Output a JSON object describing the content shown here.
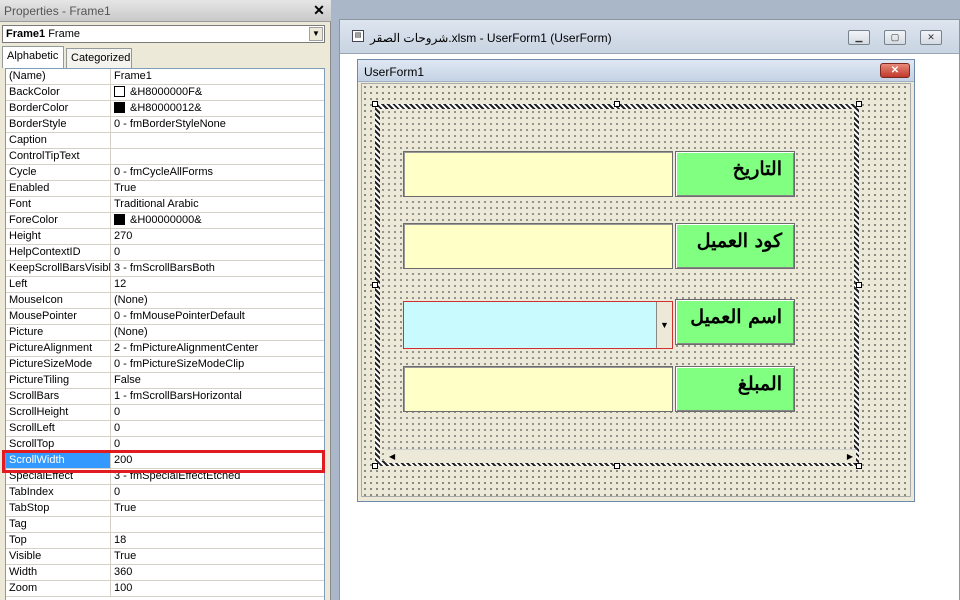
{
  "properties_panel": {
    "title": "Properties - Frame1",
    "close_glyph": "✕",
    "object_name": "Frame1",
    "object_type": "Frame",
    "tabs": [
      "Alphabetic",
      "Categorized"
    ],
    "rows": [
      {
        "name": "(Name)",
        "value": "Frame1"
      },
      {
        "name": "BackColor",
        "value": "&H8000000F&",
        "swatch": "#ffffff"
      },
      {
        "name": "BorderColor",
        "value": "&H80000012&",
        "swatch": "#000000"
      },
      {
        "name": "BorderStyle",
        "value": "0 - fmBorderStyleNone"
      },
      {
        "name": "Caption",
        "value": ""
      },
      {
        "name": "ControlTipText",
        "value": ""
      },
      {
        "name": "Cycle",
        "value": "0 - fmCycleAllForms"
      },
      {
        "name": "Enabled",
        "value": "True"
      },
      {
        "name": "Font",
        "value": "Traditional Arabic"
      },
      {
        "name": "ForeColor",
        "value": "&H00000000&",
        "swatch": "#000000"
      },
      {
        "name": "Height",
        "value": "270"
      },
      {
        "name": "HelpContextID",
        "value": "0"
      },
      {
        "name": "KeepScrollBarsVisible",
        "value": "3 - fmScrollBarsBoth"
      },
      {
        "name": "Left",
        "value": "12"
      },
      {
        "name": "MouseIcon",
        "value": "(None)"
      },
      {
        "name": "MousePointer",
        "value": "0 - fmMousePointerDefault"
      },
      {
        "name": "Picture",
        "value": "(None)"
      },
      {
        "name": "PictureAlignment",
        "value": "2 - fmPictureAlignmentCenter"
      },
      {
        "name": "PictureSizeMode",
        "value": "0 - fmPictureSizeModeClip"
      },
      {
        "name": "PictureTiling",
        "value": "False"
      },
      {
        "name": "ScrollBars",
        "value": "1 - fmScrollBarsHorizontal"
      },
      {
        "name": "ScrollHeight",
        "value": "0"
      },
      {
        "name": "ScrollLeft",
        "value": "0"
      },
      {
        "name": "ScrollTop",
        "value": "0"
      },
      {
        "name": "ScrollWidth",
        "value": "200",
        "selected": true
      },
      {
        "name": "SpecialEffect",
        "value": "3 - fmSpecialEffectEtched"
      },
      {
        "name": "TabIndex",
        "value": "0"
      },
      {
        "name": "TabStop",
        "value": "True"
      },
      {
        "name": "Tag",
        "value": ""
      },
      {
        "name": "Top",
        "value": "18"
      },
      {
        "name": "Visible",
        "value": "True"
      },
      {
        "name": "Width",
        "value": "360"
      },
      {
        "name": "Zoom",
        "value": "100"
      }
    ]
  },
  "designer": {
    "window_title": "شروحات الصقر.xlsm - UserForm1 (UserForm)",
    "buttons": [
      "▁",
      "▢",
      "✕"
    ],
    "userform_title": "UserForm1",
    "userform_close": "✕",
    "combo_arrow": "▼",
    "scroll_left": "◀",
    "scroll_right": "▶",
    "fields": [
      {
        "label": "التاريخ",
        "kind": "textbox"
      },
      {
        "label": "كود العميل",
        "kind": "textbox"
      },
      {
        "label": "اسم العميل",
        "kind": "combobox"
      },
      {
        "label": "المبلغ",
        "kind": "textbox"
      }
    ]
  },
  "colors": {
    "label_bg": "#80ff80",
    "textbox_bg": "#ffffc8",
    "combobox_bg": "#c8fafe",
    "selection": "#3399ff",
    "highlight_box": "#e11b22"
  }
}
